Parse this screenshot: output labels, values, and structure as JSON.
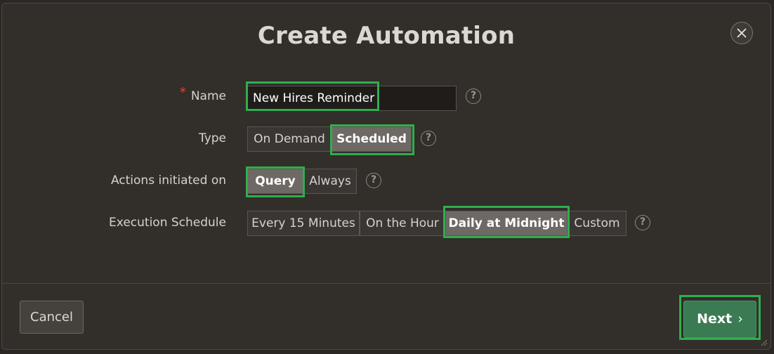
{
  "dialog": {
    "title": "Create Automation",
    "close_icon": "close-icon"
  },
  "form": {
    "name": {
      "label": "Name",
      "required_marker": "*",
      "value": "New Hires Reminder",
      "help": "?"
    },
    "type": {
      "label": "Type",
      "options": [
        "On Demand",
        "Scheduled"
      ],
      "selected": "Scheduled",
      "help": "?"
    },
    "actions_initiated_on": {
      "label": "Actions initiated on",
      "options": [
        "Query",
        "Always"
      ],
      "selected": "Query",
      "help": "?"
    },
    "execution_schedule": {
      "label": "Execution Schedule",
      "options": [
        "Every 15 Minutes",
        "On the Hour",
        "Daily at Midnight",
        "Custom"
      ],
      "selected": "Daily at Midnight",
      "help": "?"
    }
  },
  "footer": {
    "cancel_label": "Cancel",
    "next_label": "Next",
    "next_icon": "chevron-right-icon"
  },
  "colors": {
    "highlight": "#2fae4d",
    "primary_button": "#3a7b53",
    "selected_segment": "#6e6965",
    "required": "#e0452f"
  }
}
